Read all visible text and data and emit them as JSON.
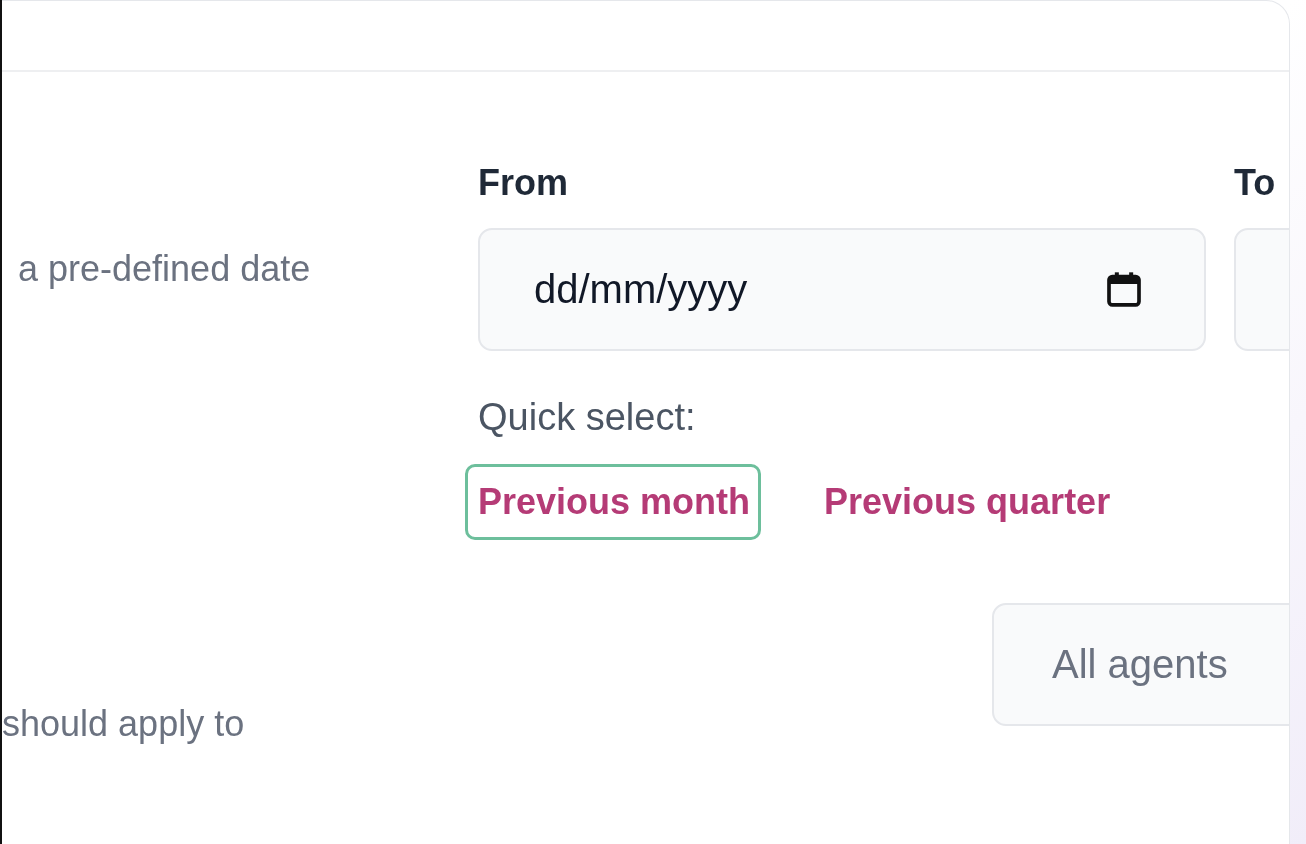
{
  "date_range": {
    "description": "a pre-defined date",
    "from": {
      "label": "From",
      "placeholder": "dd/mm/yyyy"
    },
    "to": {
      "label": "To"
    },
    "quick_select": {
      "label": "Quick select:",
      "options": [
        {
          "label": "Previous month",
          "focused": true
        },
        {
          "label": "Previous quarter",
          "focused": false
        }
      ]
    }
  },
  "agents": {
    "description": "should apply to",
    "value": "All agents"
  }
}
